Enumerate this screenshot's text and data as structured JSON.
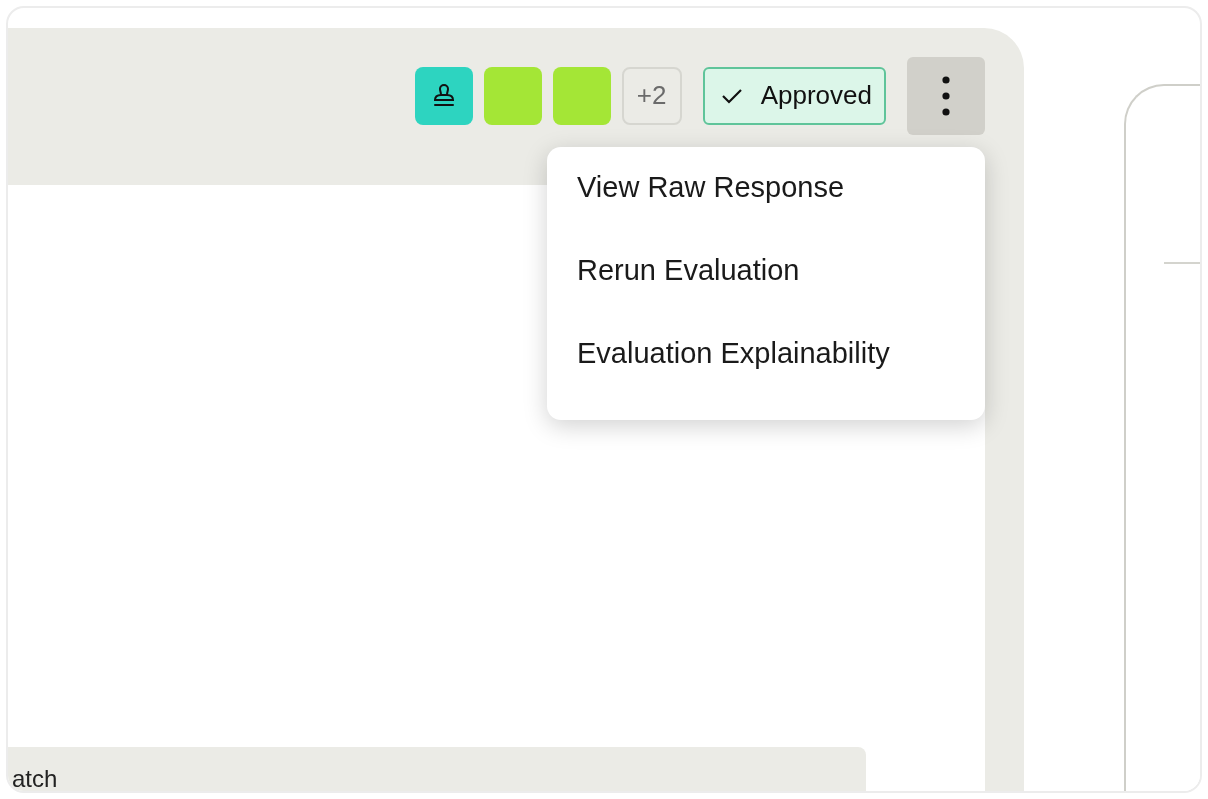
{
  "toolbar": {
    "badges": [
      {
        "kind": "icon",
        "color": "#2dd4c0"
      },
      {
        "kind": "blank",
        "color": "#a4e636"
      },
      {
        "kind": "blank",
        "color": "#a4e636"
      },
      {
        "kind": "count",
        "label": "+2"
      }
    ],
    "status": {
      "label": "Approved"
    },
    "more_menu": {
      "expanded": true,
      "items": [
        "View Raw Response",
        "Rerun Evaluation",
        "Evaluation Explainability"
      ]
    }
  },
  "section": {
    "label": "atch"
  }
}
